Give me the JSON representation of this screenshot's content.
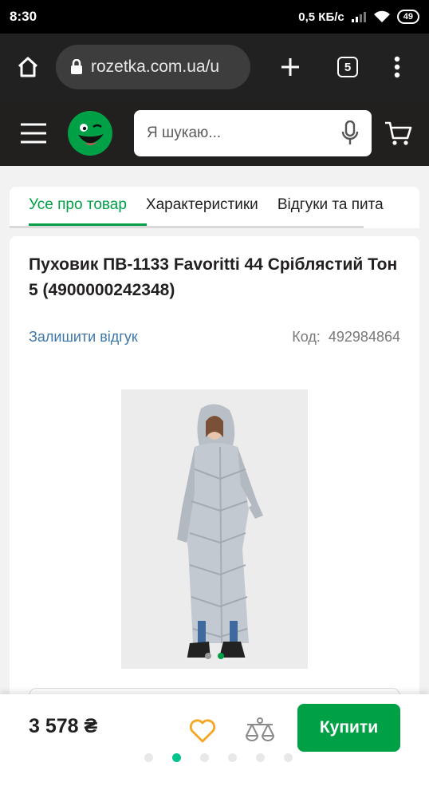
{
  "status_bar": {
    "time": "8:30",
    "speed": "0,5 КБ/с",
    "battery": "49"
  },
  "browser": {
    "url": "rozetka.com.ua/u",
    "tab_count": "5"
  },
  "header": {
    "search_placeholder": "Я шукаю..."
  },
  "tabs": [
    {
      "label": "Усе про товар"
    },
    {
      "label": "Характеристики"
    },
    {
      "label": "Відгуки та пита"
    }
  ],
  "product": {
    "title": "Пуховик ПВ-1133 Favoritti 44 Сріблястий Тон 5 (4900000242348)",
    "review_link": "Залишити відгук",
    "code_label": "Код:",
    "code_value": "492984864"
  },
  "bottom": {
    "price": "3 578 ₴",
    "buy_label": "Купити"
  },
  "colors": {
    "accent": "#00a046",
    "header_bg": "#221f1f",
    "link": "#3e77aa"
  }
}
